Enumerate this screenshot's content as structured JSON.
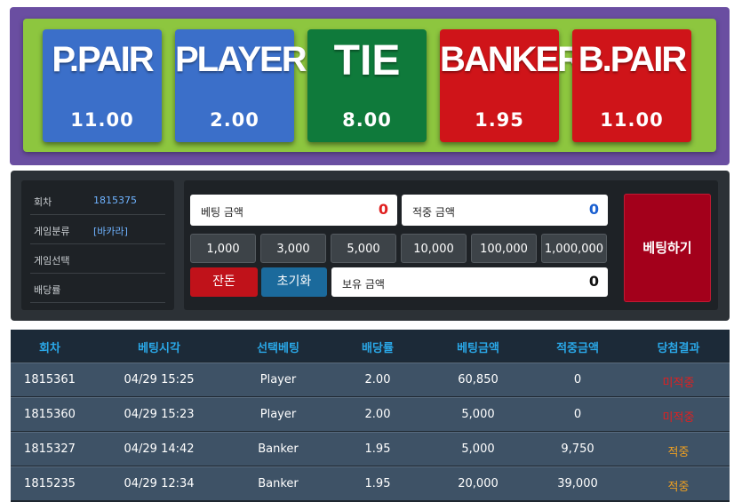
{
  "bet_options": [
    {
      "name": "P.PAIR",
      "odds": "11.00",
      "color": "#3b6fc9"
    },
    {
      "name": "PLAYER",
      "odds": "2.00",
      "color": "#3b6fc9"
    },
    {
      "name": "TIE",
      "odds": "8.00",
      "color": "#0f7a3b"
    },
    {
      "name": "BANKER",
      "odds": "1.95",
      "color": "#cf1419"
    },
    {
      "name": "B.PAIR",
      "odds": "11.00",
      "color": "#cf1419"
    }
  ],
  "info": {
    "round_label": "회차",
    "round_value": "1815375",
    "category_label": "게임분류",
    "category_value": "[바카라]",
    "selection_label": "게임선택",
    "selection_value": "",
    "odds_label": "배당률",
    "odds_value": ""
  },
  "bet_form": {
    "bet_amount_label": "베팅 금액",
    "bet_amount_value": "0",
    "win_amount_label": "적중 금액",
    "win_amount_value": "0",
    "balance_label": "보유 금액",
    "balance_value": "0",
    "chips": [
      "1,000",
      "3,000",
      "5,000",
      "10,000",
      "100,000",
      "1,000,000"
    ],
    "all_in_label": "잔돈",
    "reset_label": "초기화",
    "submit_label": "베팅하기"
  },
  "history": {
    "headers": [
      "회차",
      "베팅시각",
      "선택베팅",
      "배당률",
      "베팅금액",
      "적중금액",
      "당첨결과"
    ],
    "rows": [
      {
        "round": "1815361",
        "time": "04/29 15:25",
        "pick": "Player",
        "odds": "2.00",
        "amount": "60,850",
        "win": "0",
        "result": "미적중",
        "result_color": "#e02020"
      },
      {
        "round": "1815360",
        "time": "04/29 15:23",
        "pick": "Player",
        "odds": "2.00",
        "amount": "5,000",
        "win": "0",
        "result": "미적중",
        "result_color": "#e02020"
      },
      {
        "round": "1815327",
        "time": "04/29 14:42",
        "pick": "Banker",
        "odds": "1.95",
        "amount": "5,000",
        "win": "9,750",
        "result": "적중",
        "result_color": "#f0a020"
      },
      {
        "round": "1815235",
        "time": "04/29 12:34",
        "pick": "Banker",
        "odds": "1.95",
        "amount": "20,000",
        "win": "39,000",
        "result": "적중",
        "result_color": "#f0a020"
      }
    ]
  }
}
